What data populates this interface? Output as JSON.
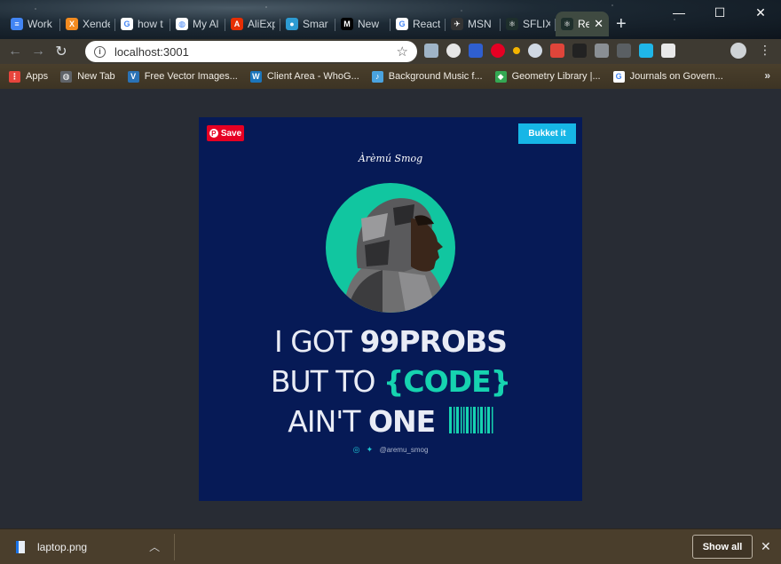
{
  "tabs": [
    {
      "label": "Work",
      "icon": "docs-icon",
      "color": "#4285f4",
      "glyph": "≡"
    },
    {
      "label": "Xende",
      "icon": "xender-icon",
      "color": "#f28b20",
      "glyph": "X"
    },
    {
      "label": "how t",
      "icon": "google-icon",
      "color": "#ffffff",
      "glyph": "G"
    },
    {
      "label": "My Al",
      "icon": "globe-icon",
      "color": "#ffffff",
      "glyph": "◍"
    },
    {
      "label": "AliExp",
      "icon": "aliexpress-icon",
      "color": "#e62e04",
      "glyph": "A"
    },
    {
      "label": "Smar",
      "icon": "smart-icon",
      "color": "#2d9bd2",
      "glyph": "●"
    },
    {
      "label": "New",
      "icon": "medium-icon",
      "color": "#000000",
      "glyph": "M"
    },
    {
      "label": "React",
      "icon": "google-icon",
      "color": "#ffffff",
      "glyph": "G"
    },
    {
      "label": "MSN",
      "icon": "msn-icon",
      "color": "#333333",
      "glyph": "✈"
    },
    {
      "label": "SFLIX",
      "icon": "react-icon",
      "color": "#1e2f2c",
      "glyph": "⚛"
    },
    {
      "label": "Re",
      "icon": "react-icon",
      "color": "#1e2f2c",
      "glyph": "⚛",
      "active": true
    }
  ],
  "window_controls": {
    "minimize": "—",
    "maximize": "☐",
    "close": "✕"
  },
  "address_bar": {
    "url": "localhost:3001"
  },
  "bookmarks": [
    {
      "label": "Apps",
      "icon": "apps-grid-icon",
      "color": "#e8453c",
      "glyph": "⋮"
    },
    {
      "label": "New Tab",
      "icon": "globe-icon",
      "color": "#5f6368",
      "glyph": "◍"
    },
    {
      "label": "Free Vector Images...",
      "icon": "vector-icon",
      "color": "#2a72b5",
      "glyph": "V"
    },
    {
      "label": "Client Area - WhoG...",
      "icon": "whogohost-icon",
      "color": "#1b75bb",
      "glyph": "W"
    },
    {
      "label": "Background Music f...",
      "icon": "music-icon",
      "color": "#4aa3df",
      "glyph": "♪"
    },
    {
      "label": "Geometry Library |...",
      "icon": "google-maps-icon",
      "color": "#34a853",
      "glyph": "◆"
    },
    {
      "label": "Journals on Govern...",
      "icon": "google-icon",
      "color": "#ffffff",
      "glyph": "G"
    }
  ],
  "poster": {
    "save_label": "Save",
    "bucket_label": "Bukket it",
    "signature": "Àrèmú Smog",
    "line1_thin": "I GOT ",
    "line1_bold": "99PROBS",
    "line2_thin": "BUT TO ",
    "line2_teal": "{CODE}",
    "line3_thin": "AIN'T ",
    "line3_bold": "ONE",
    "handle": "@aremu_smog",
    "colors": {
      "background": "#061a56",
      "accent": "#16d3b0",
      "bucket": "#16b6e6",
      "pinterest": "#e60023"
    }
  },
  "download": {
    "filename": "laptop.png",
    "show_all": "Show all"
  }
}
